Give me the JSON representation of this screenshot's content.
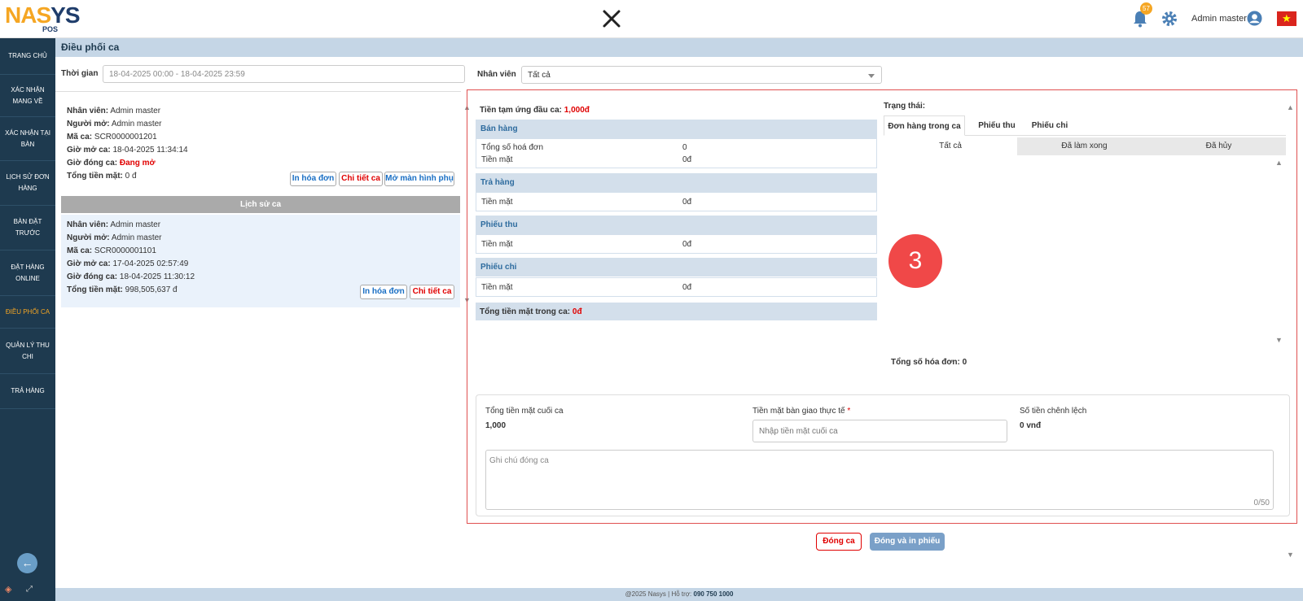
{
  "brand": {
    "logo_na": "NA",
    "logo_s": "S",
    "logo_ys": "YS",
    "logo_pos": "POS"
  },
  "header": {
    "notification_count": "57",
    "user_name": "Admin master"
  },
  "sidebar": {
    "items": [
      {
        "label": "TRANG CHỦ"
      },
      {
        "label": "XÁC NHẬN MANG VỀ"
      },
      {
        "label": "XÁC NHẬN TẠI BÀN"
      },
      {
        "label": "LỊCH SỬ ĐƠN HÀNG"
      },
      {
        "label": "BÀN ĐẶT TRƯỚC"
      },
      {
        "label": "ĐẶT HÀNG ONLINE"
      },
      {
        "label": "ĐIỀU PHỐI CA"
      },
      {
        "label": "QUẢN LÝ THU CHI"
      },
      {
        "label": "TRẢ HÀNG"
      }
    ],
    "active_index": 6
  },
  "page": {
    "title": "Điều phối ca"
  },
  "filters": {
    "time_label": "Thời gian",
    "time_value": "18-04-2025 00:00 - 18-04-2025 23:59",
    "staff_label": "Nhân viên",
    "staff_value": "Tất cả"
  },
  "current_shift": {
    "staff_label": "Nhân viên:",
    "staff": "Admin master",
    "opener_label": "Người mở:",
    "opener": "Admin master",
    "code_label": "Mã ca:",
    "code": "SCR0000001201",
    "open_label": "Giờ mở ca:",
    "open_time": "18-04-2025 11:34:14",
    "close_label": "Giờ đóng ca:",
    "close_status": "Đang mở",
    "cash_label": "Tổng tiền mặt:",
    "cash": "0 đ",
    "btn_print": "In hóa đơn",
    "btn_detail": "Chi tiết ca",
    "btn_screen": "Mở màn hình phụ"
  },
  "history": {
    "title": "Lịch sử ca",
    "item": {
      "staff_label": "Nhân viên:",
      "staff": "Admin master",
      "opener_label": "Người mở:",
      "opener": "Admin master",
      "code_label": "Mã ca:",
      "code": "SCR0000001101",
      "open_label": "Giờ mở ca:",
      "open_time": "17-04-2025 02:57:49",
      "close_label": "Giờ đóng ca:",
      "close_time": "18-04-2025 11:30:12",
      "cash_label": "Tổng tiền mặt:",
      "cash": "998,505,637 đ",
      "btn_print": "In hóa đơn",
      "btn_detail": "Chi tiết ca"
    }
  },
  "detail": {
    "advance_label": "Tiền tạm ứng đầu ca:",
    "advance_value": "1,000đ",
    "sales": {
      "title": "Bán hàng",
      "invoices_label": "Tổng số hoá đơn",
      "invoices_value": "0",
      "cash_label": "Tiền mặt",
      "cash_value": "0đ"
    },
    "returns": {
      "title": "Trả hàng",
      "cash_label": "Tiền mặt",
      "cash_value": "0đ"
    },
    "receipts": {
      "title": "Phiếu thu",
      "cash_label": "Tiền mặt",
      "cash_value": "0đ"
    },
    "payments": {
      "title": "Phiếu chi",
      "cash_label": "Tiền mặt",
      "cash_value": "0đ"
    },
    "total_label": "Tổng tiền mặt trong ca:",
    "total_value": "0đ"
  },
  "status": {
    "label": "Trạng thái:",
    "tabs": [
      "Đơn hàng trong ca",
      "Phiếu thu",
      "Phiếu chi"
    ],
    "subtabs": [
      "Tất cả",
      "Đã làm xong",
      "Đã hủy"
    ],
    "total_invoices_label": "Tổng số hóa đơn:",
    "total_invoices_value": "0"
  },
  "annotation": {
    "marker": "3",
    "color": "#f04848"
  },
  "close_form": {
    "end_cash_label": "Tổng tiền mặt cuối ca",
    "end_cash_value": "1,000",
    "handover_label": "Tiền mặt bàn giao thực tế",
    "required_mark": "*",
    "handover_placeholder": "Nhập tiền mặt cuối ca",
    "diff_label": "Số tiền chênh lệch",
    "diff_value": "0 vnđ",
    "note_placeholder": "Ghi chú đóng ca",
    "note_counter": "0/50"
  },
  "actions": {
    "close": "Đóng ca",
    "close_print": "Đóng và in phiếu"
  },
  "footer": {
    "text": "@2025 Nasys | Hỗ trợ:",
    "phone": "090 750 1000"
  }
}
